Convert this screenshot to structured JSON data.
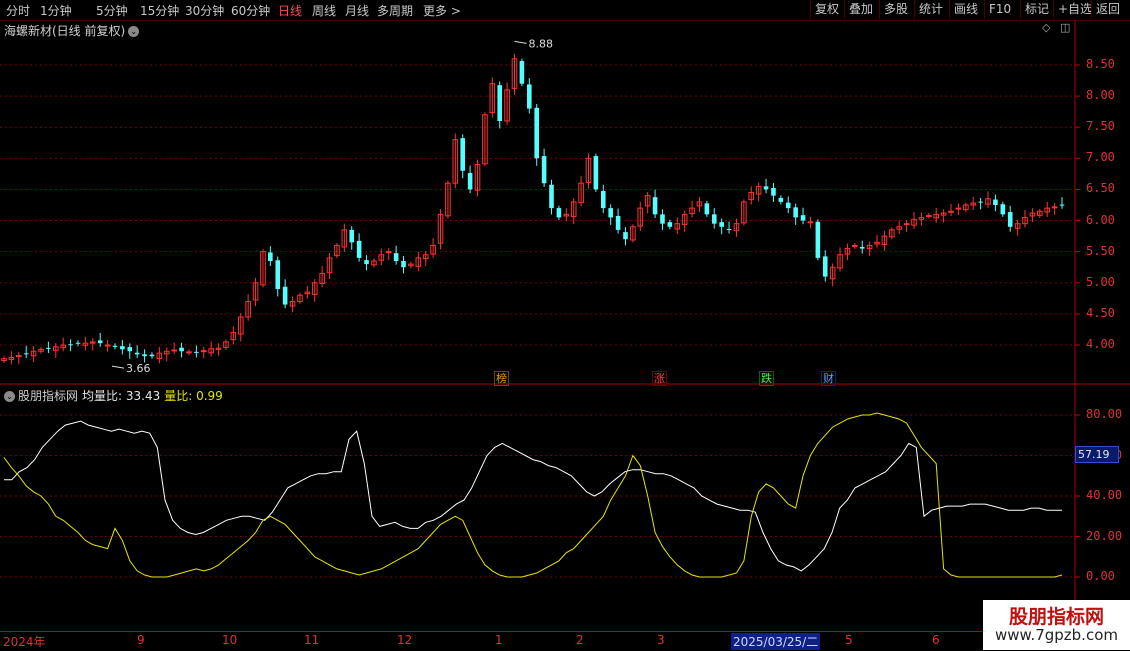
{
  "periods": [
    "分时",
    "1分钟",
    "5分钟",
    "15分钟",
    "30分钟",
    "60分钟",
    "日线",
    "周线",
    "月线",
    "多周期",
    "更多 >"
  ],
  "active_period": "日线",
  "tools": [
    "复权",
    "叠加",
    "多股",
    "统计",
    "画线",
    "F10",
    "+自选",
    "返回"
  ],
  "tools_with_mark": "标记",
  "stock_title": "海螺新材(日线 前复权)",
  "main_yticks": [
    "8.50",
    "8.00",
    "7.50",
    "7.00",
    "6.50",
    "6.00",
    "5.50",
    "5.00",
    "4.50",
    "4.00"
  ],
  "high_label": "8.88",
  "low_label": "3.66",
  "events": [
    "榜",
    "涨",
    "跌",
    "财"
  ],
  "indicator": {
    "name": "股朋指标网",
    "label1": "均量比: 33.43",
    "label2": "量比: 0.99"
  },
  "ind_yticks": [
    "80.00",
    "60.00",
    "40.00",
    "20.00",
    "0.00"
  ],
  "cursor_value": "57.19",
  "xlabels": [
    "2024年",
    "9",
    "10",
    "11",
    "12",
    "1",
    "2",
    "3",
    "2025/03/25/二",
    "5",
    "6"
  ],
  "watermark": {
    "title": "股朋指标网",
    "url": "www.7gpzb.com"
  },
  "colors": {
    "up": "#ff3232",
    "down": "#54ffff",
    "line1": "#ffffff",
    "line2": "#e6e600",
    "grid": "#7a0000"
  },
  "chart_data": {
    "type": "line",
    "candle_closes": [
      3.78,
      3.8,
      3.83,
      3.85,
      3.9,
      3.93,
      3.95,
      3.97,
      4.0,
      4.0,
      4.02,
      4.03,
      4.05,
      4.03,
      4.0,
      3.97,
      3.93,
      3.9,
      3.85,
      3.82,
      3.82,
      3.87,
      3.9,
      3.92,
      3.9,
      3.89,
      3.88,
      3.91,
      3.94,
      3.95,
      4.05,
      4.2,
      4.45,
      4.7,
      5.0,
      5.5,
      5.35,
      4.9,
      4.65,
      4.7,
      4.8,
      4.85,
      5.0,
      5.15,
      5.4,
      5.6,
      5.85,
      5.65,
      5.4,
      5.3,
      5.35,
      5.45,
      5.5,
      5.35,
      5.25,
      5.3,
      5.4,
      5.45,
      5.6,
      6.1,
      6.6,
      7.3,
      6.8,
      6.5,
      6.9,
      7.7,
      8.2,
      7.6,
      8.1,
      8.6,
      8.2,
      7.8,
      7.0,
      6.6,
      6.2,
      6.05,
      6.1,
      6.3,
      6.6,
      7.0,
      6.5,
      6.2,
      6.05,
      5.85,
      5.7,
      5.9,
      6.2,
      6.4,
      6.1,
      5.95,
      5.9,
      5.95,
      6.1,
      6.2,
      6.3,
      6.1,
      5.95,
      5.9,
      5.85,
      5.95,
      6.3,
      6.45,
      6.55,
      6.5,
      6.4,
      6.3,
      6.2,
      6.05,
      6.0,
      5.98,
      5.4,
      5.1,
      5.25,
      5.45,
      5.55,
      5.6,
      5.55,
      5.6,
      5.65,
      5.75,
      5.85,
      5.9,
      5.95,
      6.02,
      6.05,
      6.08,
      6.1,
      6.12,
      6.15,
      6.2,
      6.25,
      6.28,
      6.3,
      6.35,
      6.25,
      6.1,
      5.9,
      5.95,
      6.05,
      6.12,
      6.15,
      6.2,
      6.22,
      6.25
    ],
    "y_range": [
      3.5,
      9.0
    ],
    "ind_series": [
      {
        "name": "均量比",
        "values": [
          48,
          48,
          52,
          54,
          58,
          64,
          68,
          72,
          75,
          76,
          77,
          75,
          74,
          73,
          72,
          73,
          72,
          71,
          72,
          71,
          64,
          38,
          28,
          24,
          22,
          21,
          22,
          24,
          26,
          28,
          29,
          30,
          30,
          29,
          28,
          32,
          38,
          44,
          46,
          48,
          50,
          51,
          51,
          52,
          52,
          68,
          72,
          56,
          30,
          25,
          26,
          27,
          25,
          24,
          24,
          27,
          28,
          30,
          33,
          36,
          38,
          44,
          52,
          60,
          64,
          66,
          64,
          62,
          60,
          58,
          57,
          55,
          54,
          52,
          50,
          46,
          42,
          40,
          42,
          46,
          49,
          52,
          53,
          53,
          52,
          51,
          51,
          50,
          48,
          46,
          44,
          40,
          38,
          36,
          35,
          34,
          33,
          33,
          32,
          22,
          14,
          8,
          6,
          5,
          3,
          6,
          10,
          14,
          22,
          34,
          38,
          44,
          46,
          48,
          50,
          52,
          56,
          60,
          66,
          64,
          30,
          33,
          34,
          35,
          35,
          35,
          36,
          36,
          36,
          35,
          34,
          33,
          33,
          33,
          34,
          34,
          33,
          33,
          33
        ]
      },
      {
        "name": "量比",
        "values": [
          59,
          54,
          50,
          45,
          42,
          40,
          36,
          30,
          28,
          25,
          22,
          18,
          16,
          15,
          14,
          24,
          18,
          8,
          3,
          1,
          0,
          0,
          0,
          1,
          2,
          3,
          4,
          3,
          4,
          6,
          9,
          12,
          15,
          18,
          22,
          28,
          30,
          28,
          26,
          22,
          18,
          14,
          10,
          8,
          6,
          4,
          3,
          2,
          1,
          2,
          3,
          4,
          6,
          8,
          10,
          12,
          14,
          18,
          22,
          26,
          28,
          30,
          28,
          20,
          12,
          6,
          3,
          1,
          0,
          0,
          0,
          1,
          2,
          4,
          6,
          8,
          12,
          14,
          18,
          22,
          26,
          30,
          38,
          44,
          50,
          60,
          55,
          40,
          22,
          15,
          10,
          6,
          3,
          1,
          0,
          0,
          0,
          0,
          1,
          2,
          8,
          30,
          42,
          46,
          44,
          40,
          36,
          34,
          50,
          60,
          66,
          70,
          74,
          76,
          78,
          79,
          80,
          80,
          81,
          80,
          79,
          78,
          76,
          70,
          64,
          60,
          56,
          4,
          1,
          0,
          0,
          0,
          0,
          0,
          0,
          0,
          0,
          0,
          0,
          0,
          0,
          0,
          0,
          1
        ]
      }
    ],
    "ind_y_range": [
      -20,
      90
    ]
  }
}
